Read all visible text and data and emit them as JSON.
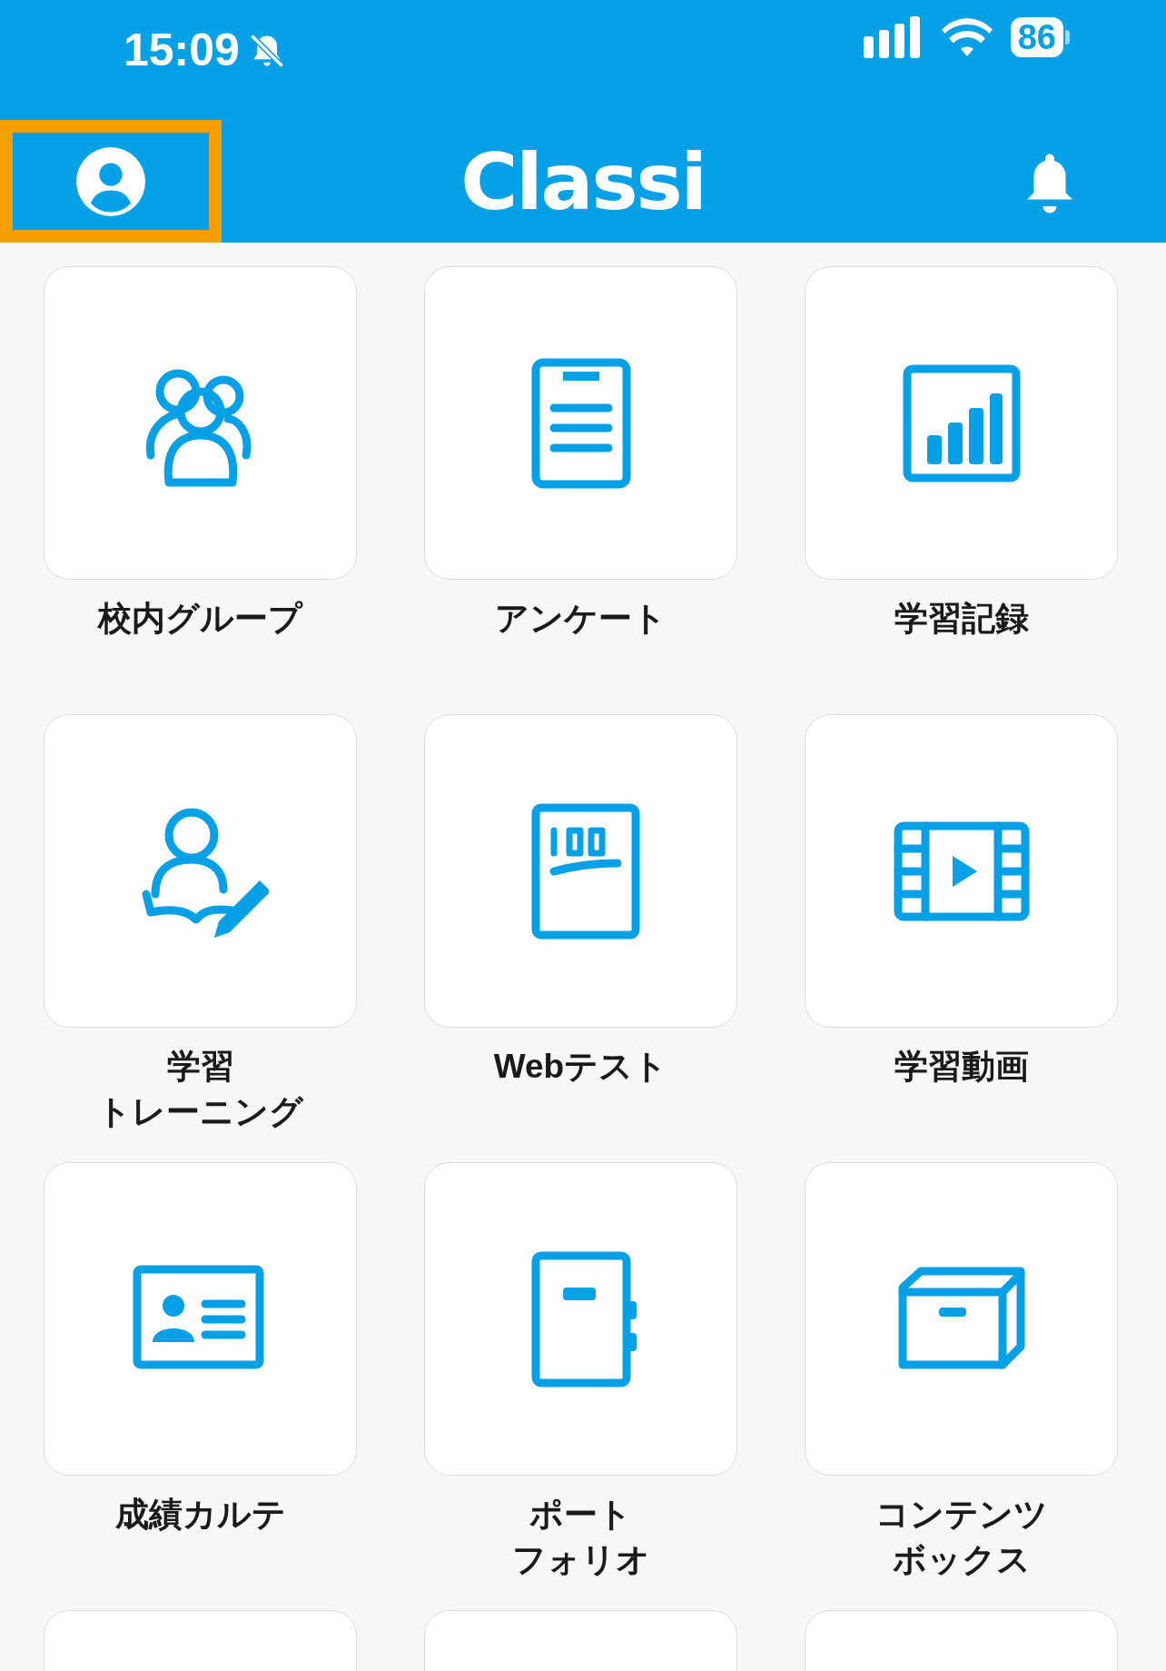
{
  "status_bar": {
    "time": "15:09",
    "battery": "86"
  },
  "header": {
    "title": "Classi",
    "profile_highlighted": true
  },
  "tiles": [
    {
      "kind": "group",
      "label": [
        "校内グループ"
      ]
    },
    {
      "kind": "survey",
      "label": [
        "アンケート"
      ]
    },
    {
      "kind": "record",
      "label": [
        "学習記録"
      ]
    },
    {
      "kind": "training",
      "label": [
        "学習",
        "トレーニング"
      ]
    },
    {
      "kind": "webtest",
      "label": [
        "Webテスト"
      ]
    },
    {
      "kind": "video",
      "label": [
        "学習動画"
      ]
    },
    {
      "kind": "karte",
      "label": [
        "成績カルテ"
      ]
    },
    {
      "kind": "portfolio",
      "label": [
        "ポート",
        "フォリオ"
      ]
    },
    {
      "kind": "contents",
      "label": [
        "コンテンツ",
        "ボックス"
      ]
    },
    {
      "kind": "blank"
    },
    {
      "kind": "blank"
    },
    {
      "kind": "blank"
    }
  ]
}
